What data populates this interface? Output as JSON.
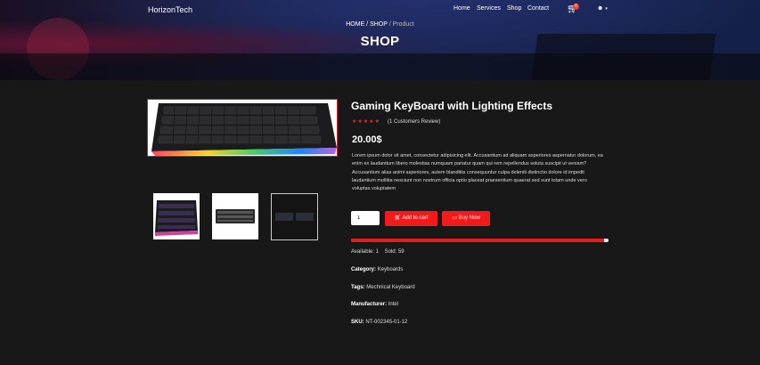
{
  "header": {
    "brand": "HorizonTech",
    "nav": [
      "Home",
      "Services",
      "Shop",
      "Contact"
    ],
    "cart_badge": "0",
    "icons": [
      "cart-icon",
      "user-icon",
      "caret-down-icon"
    ]
  },
  "hero": {
    "breadcrumb": {
      "home": "HOME",
      "sep1": " / ",
      "shop": "SHOP",
      "sep2": " / ",
      "current": "Product"
    },
    "title": "SHOP"
  },
  "product": {
    "title": "Gaming KeyBoard with Lighting Effects",
    "rating": 5,
    "stars": "★★★★★",
    "review_text": "(1 Customers Review)",
    "price": "20.00$",
    "description": "Lorem ipsum dolor sit amet, consectetur adipisicing elit. Accusantium ad aliquam asperiores aspernatur dolorum, ea enim ex laudantium libero molestias numquam pariatur quam qui rem repellendus soluta suscipit ut veniam?Accusantium alias animi asperiores, autem blanditiis consequuntur culpa deleniti distinctio dolore id impedit laudantium mollitia nesciunt non nostrum officia optio placeat praesentium quaerat sed sunt totam unde vero voluptas voluptatem",
    "quantity": "1",
    "add_to_cart": "Add to cart",
    "buy_now": "Buy Now",
    "sold_fraction": 0.983,
    "available_label": "Available:",
    "available": "1",
    "sold_label": "Sold:",
    "sold": "59",
    "category_label": "Category:",
    "category": "Keyboards",
    "tags_label": "Tags:",
    "tags": "Mechnical Keyboard",
    "manufacturer_label": "Manufacturer:",
    "manufacturer": "Intel",
    "sku_label": "SKU:",
    "sku": "NT-002345-01-12"
  },
  "colors": {
    "accent": "#f11b1b",
    "background": "#181818",
    "text": "#ffffff"
  }
}
